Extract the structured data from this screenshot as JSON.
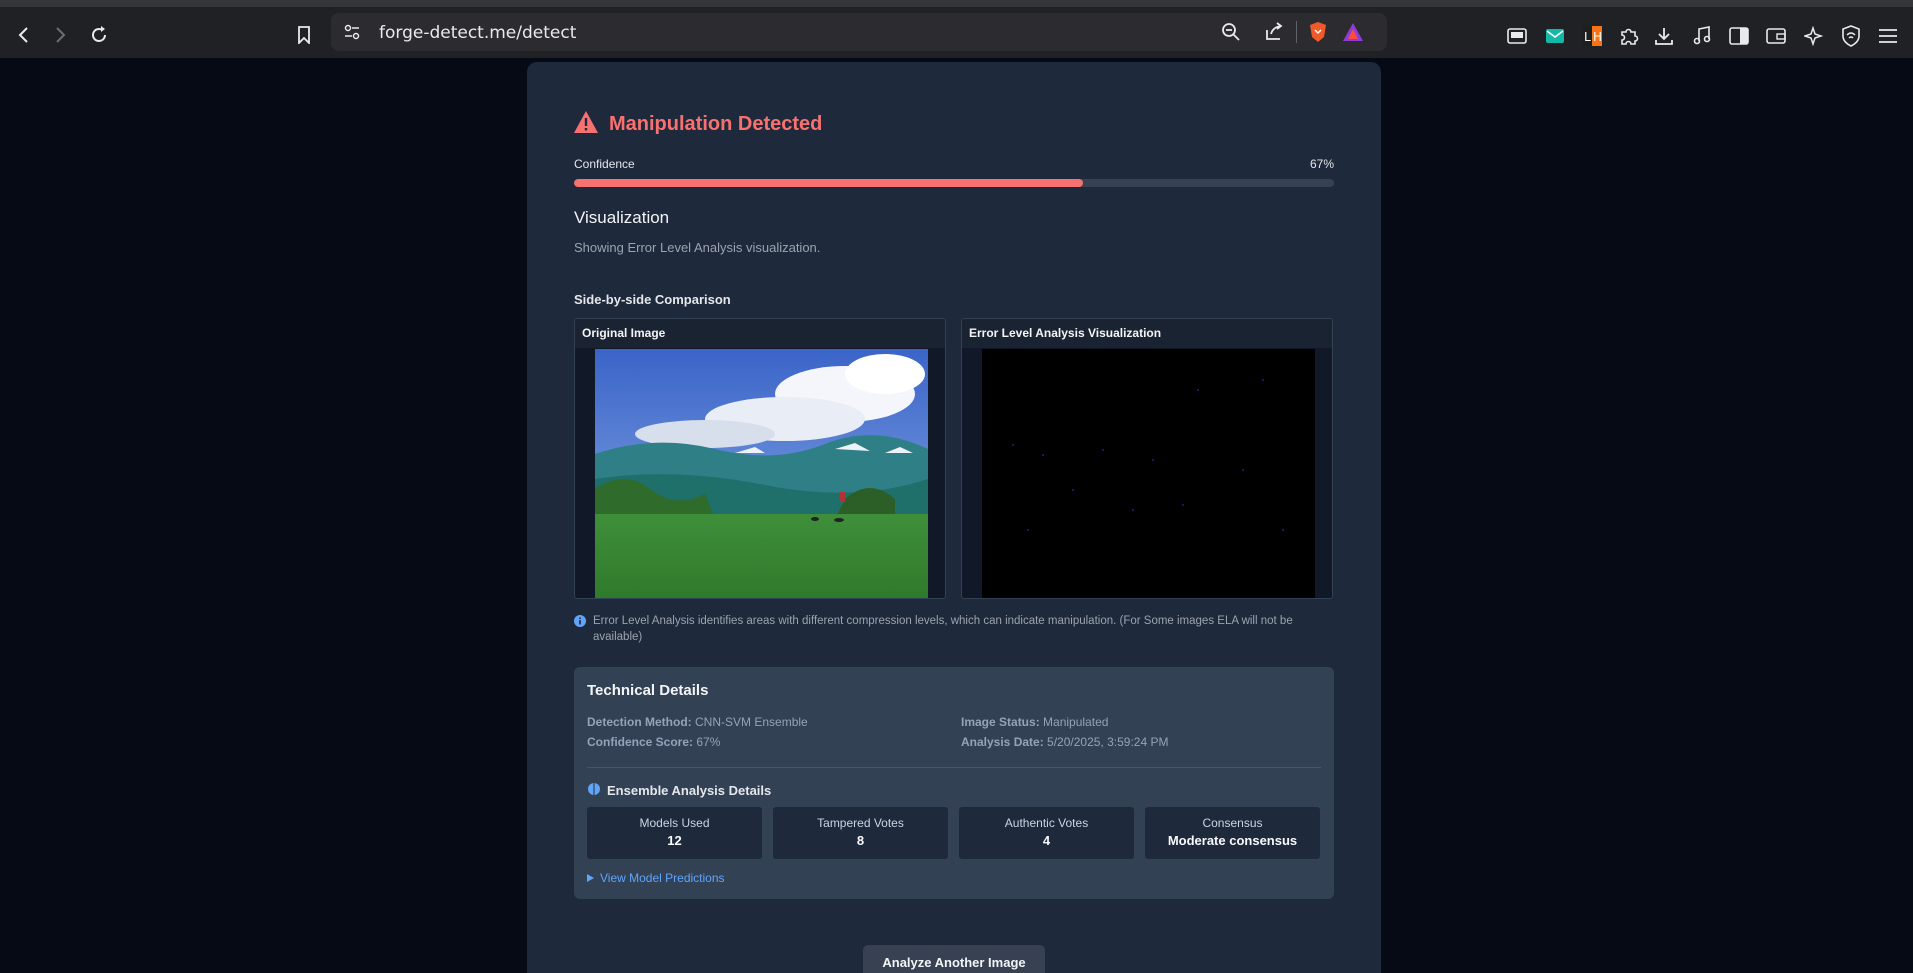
{
  "browser": {
    "url": "forge-detect.me/detect"
  },
  "result": {
    "title": "Manipulation Detected",
    "confidence_label": "Confidence",
    "confidence_text": "67%",
    "confidence_value": 0.67,
    "status_color": "#f87171"
  },
  "visualization": {
    "title": "Visualization",
    "subtitle": "Showing Error Level Analysis visualization.",
    "comparison_title": "Side-by-side Comparison",
    "original_label": "Original Image",
    "ela_label": "Error Level Analysis Visualization",
    "note": "Error Level Analysis identifies areas with different compression levels, which can indicate manipulation. (For Some images ELA will not be available)"
  },
  "technical": {
    "title": "Technical Details",
    "method_label": "Detection Method:",
    "method_value": "CNN-SVM Ensemble",
    "score_label": "Confidence Score:",
    "score_value": "67%",
    "status_label": "Image Status:",
    "status_value": "Manipulated",
    "date_label": "Analysis Date:",
    "date_value": "5/20/2025, 3:59:24 PM"
  },
  "ensemble": {
    "title": "Ensemble Analysis Details",
    "stats": [
      {
        "label": "Models Used",
        "value": "12"
      },
      {
        "label": "Tampered Votes",
        "value": "8"
      },
      {
        "label": "Authentic Votes",
        "value": "4"
      },
      {
        "label": "Consensus",
        "value": "Moderate consensus"
      }
    ],
    "view_link": "View Model Predictions"
  },
  "actions": {
    "analyze_again": "Analyze Another Image"
  }
}
